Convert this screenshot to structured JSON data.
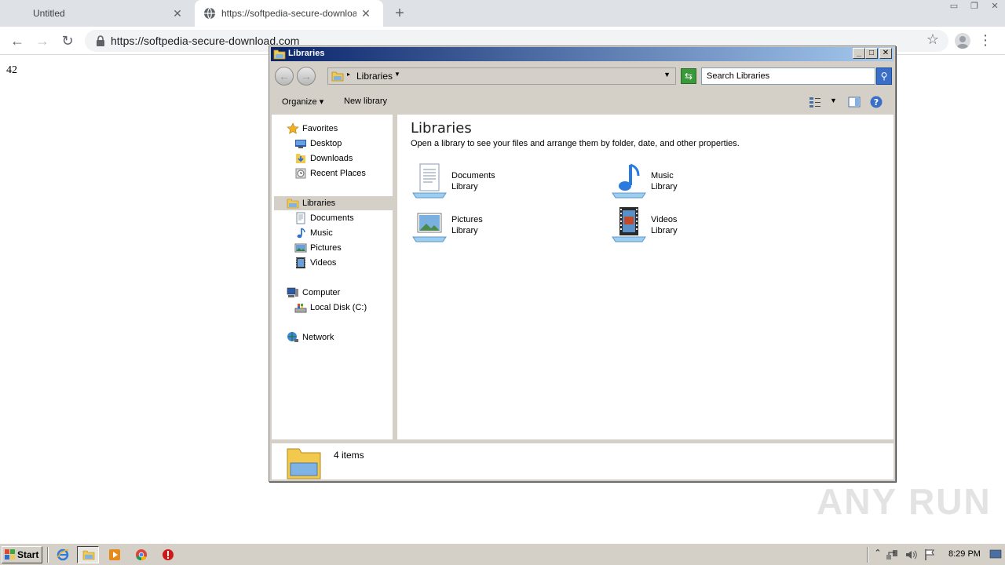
{
  "browser": {
    "tabs": [
      {
        "title": "Untitled",
        "active": false
      },
      {
        "title": "https://softpedia-secure-download.c",
        "active": true
      }
    ],
    "url": "https://softpedia-secure-download.com"
  },
  "page": {
    "body_text": "42"
  },
  "explorer": {
    "title": "Libraries",
    "address": {
      "location": "Libraries"
    },
    "search_placeholder": "Search Libraries",
    "commands": {
      "organize": "Organize",
      "new_library": "New library"
    },
    "nav": {
      "favorites": "Favorites",
      "desktop": "Desktop",
      "downloads": "Downloads",
      "recent_places": "Recent Places",
      "libraries": "Libraries",
      "documents": "Documents",
      "music": "Music",
      "pictures": "Pictures",
      "videos": "Videos",
      "computer": "Computer",
      "local_disk": "Local Disk (C:)",
      "network": "Network"
    },
    "content": {
      "heading": "Libraries",
      "description": "Open a library to see your files and arrange them by folder, date, and other properties.",
      "libraries": [
        {
          "name": "Documents",
          "type": "Library",
          "icon": "documents-library-icon"
        },
        {
          "name": "Music",
          "type": "Library",
          "icon": "music-library-icon"
        },
        {
          "name": "Pictures",
          "type": "Library",
          "icon": "pictures-library-icon"
        },
        {
          "name": "Videos",
          "type": "Library",
          "icon": "videos-library-icon"
        }
      ]
    },
    "details": {
      "item_count": "4 items"
    }
  },
  "watermark": "ANY RUN",
  "taskbar": {
    "start_label": "Start",
    "clock": "8:29 PM"
  },
  "colors": {
    "titlebar_start": "#0a246a",
    "titlebar_end": "#a6caf0",
    "chrome_tabstrip": "#dee1e6",
    "classic_face": "#d4d0c8"
  }
}
